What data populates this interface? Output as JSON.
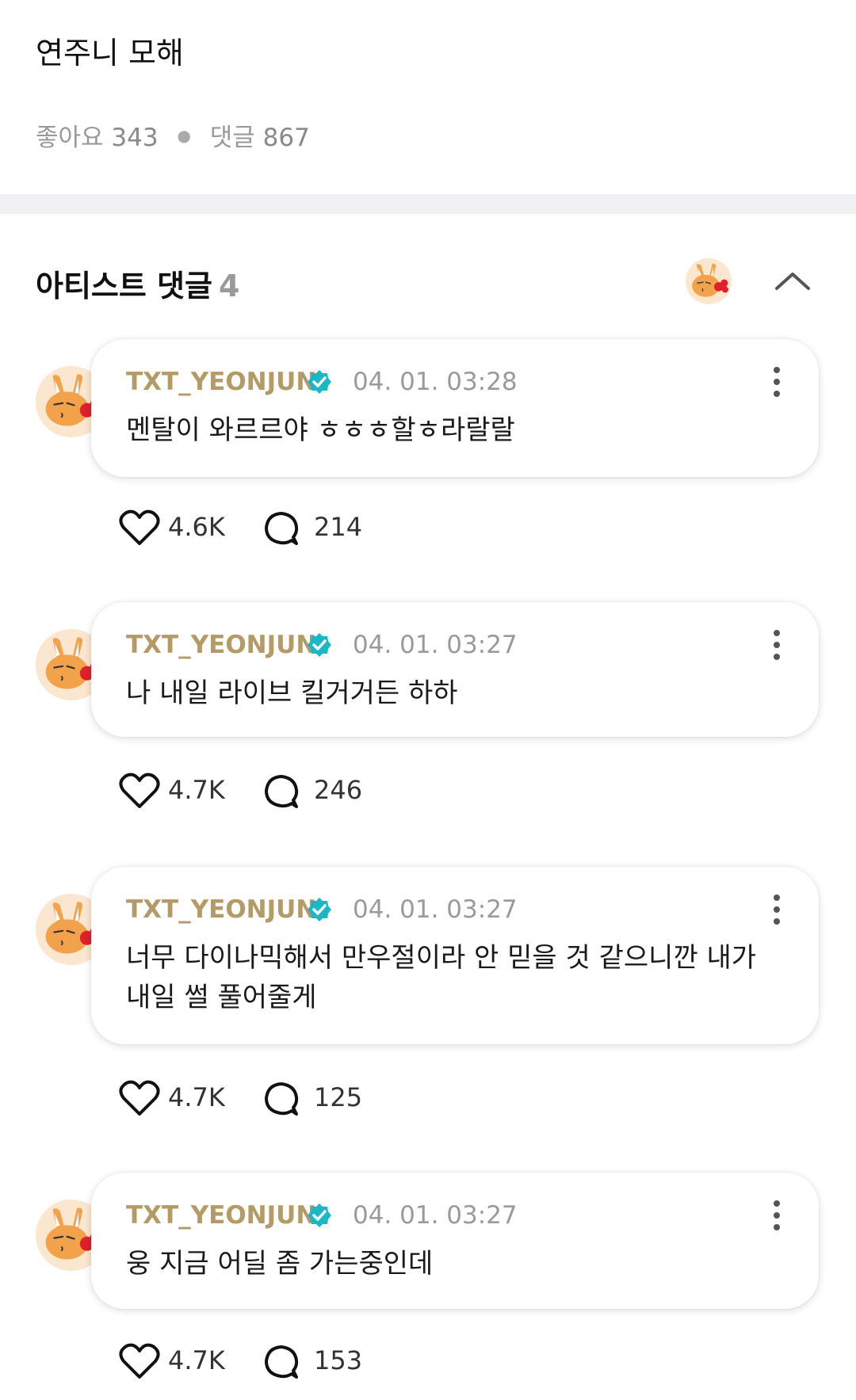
{
  "post": {
    "title": "연주니 모해",
    "likes_label": "좋아요",
    "likes_count": "343",
    "comments_label": "댓글",
    "comments_count": "867"
  },
  "artist_section": {
    "title": "아티스트 댓글",
    "count": "4"
  },
  "icons": {
    "avatar": "bunny-avatar-icon",
    "verified": "verified-badge-icon",
    "more": "more-vertical-icon",
    "like": "heart-icon",
    "reply": "comment-bubble-icon",
    "collapse": "chevron-up-icon"
  },
  "colors": {
    "username": "#b49a66",
    "verified_badge": "#1ab8c6",
    "avatar_bg": "#fbe6cf"
  },
  "comments": [
    {
      "username": "TXT_YEONJUN",
      "timestamp": "04. 01. 03:28",
      "text": "멘탈이 와르르야 ㅎㅎㅎ할ㅎ라랄랄",
      "likes": "4.6K",
      "replies": "214"
    },
    {
      "username": "TXT_YEONJUN",
      "timestamp": "04. 01. 03:27",
      "text": "나 내일 라이브 킬거거든 하하",
      "likes": "4.7K",
      "replies": "246"
    },
    {
      "username": "TXT_YEONJUN",
      "timestamp": "04. 01. 03:27",
      "text": "너무 다이나믹해서 만우절이라 안 믿을 것 같으니깐 내가 내일 썰 풀어줄게",
      "likes": "4.7K",
      "replies": "125"
    },
    {
      "username": "TXT_YEONJUN",
      "timestamp": "04. 01. 03:27",
      "text": "웅 지금 어딜 좀 가는중인데",
      "likes": "4.7K",
      "replies": "153"
    }
  ]
}
